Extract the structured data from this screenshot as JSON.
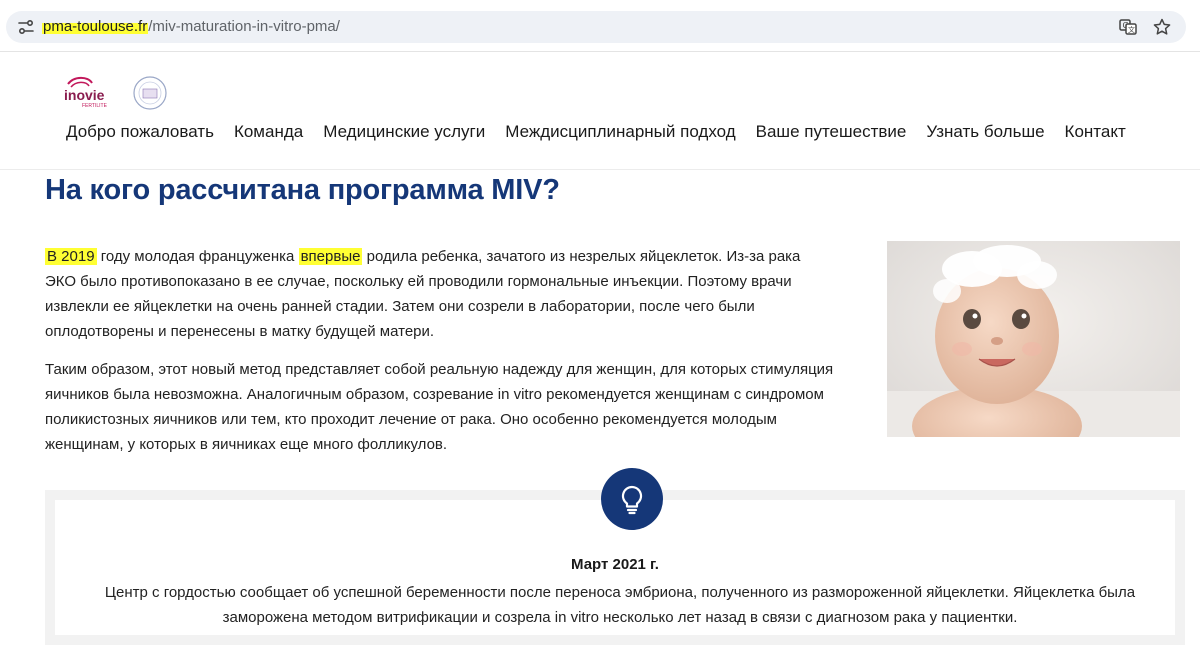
{
  "browser": {
    "url_host": "pma-toulouse.fr",
    "url_path": "/miv-maturation-in-vitro-pma/",
    "icons": [
      "site-info-icon",
      "translate-icon",
      "bookmark-star-icon"
    ]
  },
  "site": {
    "logo_text": "inovie",
    "logo_subtext": "FERTILITE",
    "nav": [
      "Добро пожаловать",
      "Команда",
      "Медицинские услуги",
      "Междисциплинарный подход",
      "Ваше путешествие",
      "Узнать больше",
      "Контакт"
    ]
  },
  "main": {
    "title": "На кого рассчитана программа MIV?",
    "p1": {
      "highlight1": "В 2019",
      "part1": " году молодая француженка ",
      "highlight2": "впервые",
      "part2": " родила ребенка, зачатого из незрелых яйцеклеток. Из-за рака ЭКО было противопоказано в ее случае, поскольку ей проводили гормональные инъекции. Поэтому врачи извлекли ее яйцеклетки на очень ранней стадии. Затем они созрели в лаборатории, после чего были оплодотворены и перенесены в матку будущей матери."
    },
    "p2": "Таким образом, этот новый метод представляет собой реальную надежду для женщин, для которых стимуляция яичников была невозможна. Аналогичным образом, созревание in vitro рекомендуется женщинам с синдромом поликистозных яичников или тем, кто проходит лечение от рака. Оно особенно рекомендуется молодым женщинам, у которых в яичниках еще много фолликулов.",
    "info": {
      "date": "Март 2021 г.",
      "text": "Центр с гордостью сообщает об успешной беременности после переноса эмбриона, полученного из размороженной яйцеклетки. Яйцеклетка была заморожена методом витрификации и созрела in vitro несколько лет назад в связи с диагнозом рака у пациентки."
    }
  },
  "colors": {
    "accent": "#153778",
    "highlight": "#ffff33"
  }
}
